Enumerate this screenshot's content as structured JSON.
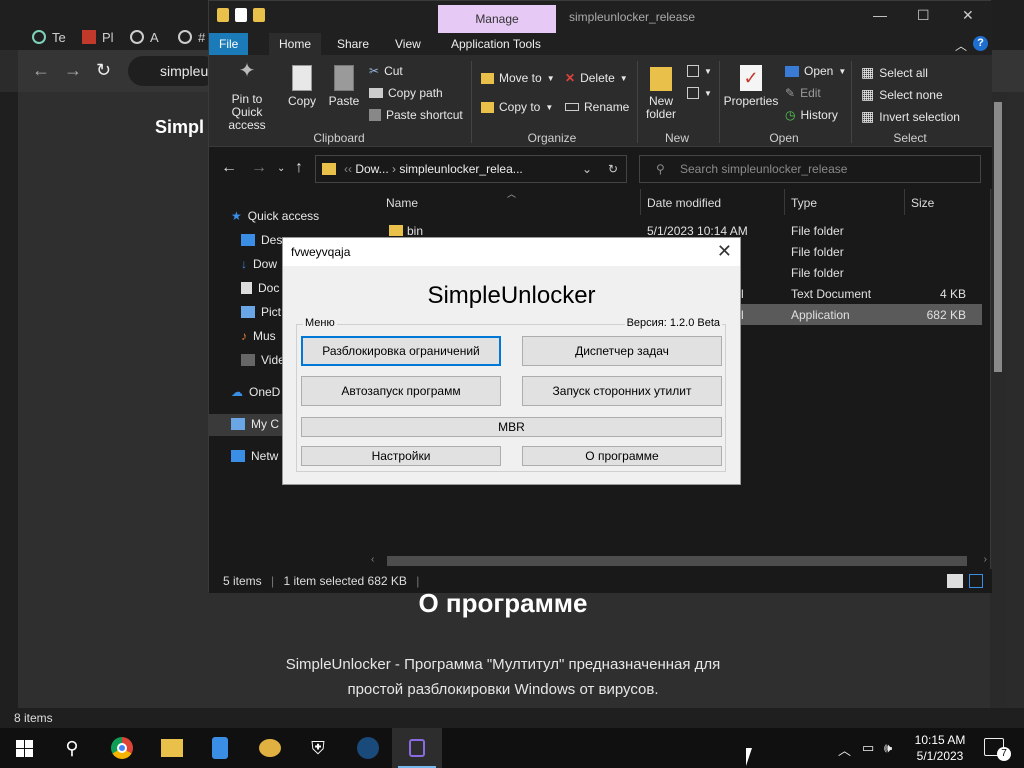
{
  "browser": {
    "tabs": [
      {
        "label": "Te",
        "icon": "tab-icon"
      },
      {
        "label": "Pl",
        "icon": "pdf-icon"
      },
      {
        "label": "A",
        "icon": "steam-icon"
      },
      {
        "label": "#",
        "icon": "globe-icon"
      }
    ],
    "omnibox": "simpleu",
    "page_header": "Simpl",
    "about_title": "О программе",
    "about_text_1": "SimpleUnlocker - Программа \"Мултитул\" предназначенная для",
    "about_text_2": "простой разблокировки Windows от вирусов.",
    "status": "8 items"
  },
  "explorer": {
    "title": "simpleunlocker_release",
    "manage_tab": "Manage",
    "menu": [
      "File",
      "Home",
      "Share",
      "View",
      "Application Tools"
    ],
    "ribbon": {
      "pin": "Pin to Quick access",
      "copy": "Copy",
      "paste": "Paste",
      "cut": "Cut",
      "copy_path": "Copy path",
      "paste_shortcut": "Paste shortcut",
      "clipboard": "Clipboard",
      "move_to": "Move to",
      "copy_to": "Copy to",
      "delete": "Delete",
      "rename": "Rename",
      "organize": "Organize",
      "new_folder": "New folder",
      "new": "New",
      "properties": "Properties",
      "open": "Open",
      "edit": "Edit",
      "history": "History",
      "open_group": "Open",
      "select_all": "Select all",
      "select_none": "Select none",
      "invert_selection": "Invert selection",
      "select": "Select"
    },
    "address": {
      "prefix": "Dow...",
      "current": "simpleunlocker_relea..."
    },
    "search_placeholder": "Search simpleunlocker_release",
    "nav": [
      "Quick access",
      "Des",
      "Dow",
      "Doc",
      "Pict",
      "Mus",
      "Vide",
      "OneD",
      "My C",
      "Netw"
    ],
    "columns": [
      "Name",
      "Date modified",
      "Type",
      "Size"
    ],
    "rows": [
      {
        "name": "bin",
        "date": "5/1/2023 10:14 AM",
        "type": "File folder",
        "size": ""
      },
      {
        "name": "",
        "date": "",
        "type": "File folder",
        "size": ""
      },
      {
        "name": "",
        "date": "",
        "type": "File folder",
        "size": ""
      },
      {
        "name": "",
        "date": "l",
        "type": "Text Document",
        "size": "4 KB"
      },
      {
        "name": "",
        "date": "l",
        "type": "Application",
        "size": "682 KB"
      }
    ],
    "status_items": "5 items",
    "status_selected": "1 item selected  682 KB"
  },
  "dialog": {
    "title": "fvweyvqaja",
    "app_name": "SimpleUnlocker",
    "menu_label": "Меню",
    "version": "Версия: 1.2.0 Beta",
    "buttons": {
      "unlock": "Разблокировка ограничений",
      "task_manager": "Диспетчер задач",
      "autorun": "Автозапуск программ",
      "third_party": "Запуск сторонних утилит",
      "mbr": "MBR",
      "settings": "Настройки",
      "about": "О программе"
    }
  },
  "taskbar": {
    "time": "10:15 AM",
    "date": "5/1/2023",
    "notifications": "7"
  },
  "colors": {
    "accent": "#0078d7",
    "manage_tab": "#e6c9f5",
    "file_tab": "#1b7ab8"
  }
}
